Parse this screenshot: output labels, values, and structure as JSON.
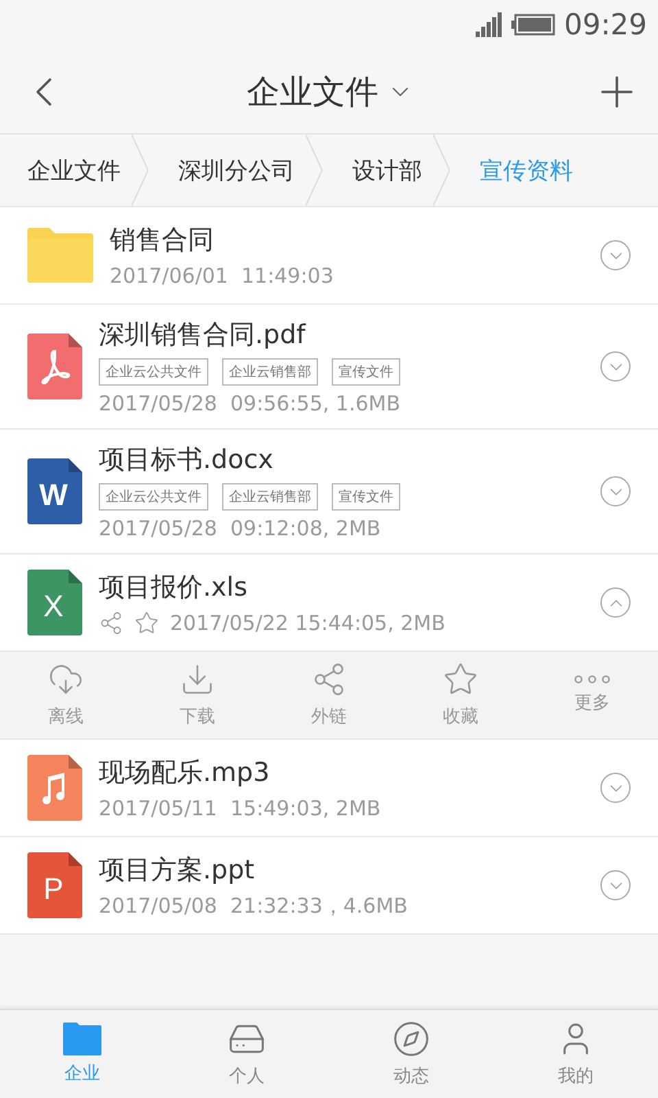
{
  "status_bar": {
    "time": "09:29"
  },
  "header": {
    "title": "企业文件"
  },
  "breadcrumbs": [
    {
      "label": "企业文件",
      "selected": false
    },
    {
      "label": "深圳分公司",
      "selected": false
    },
    {
      "label": "设计部",
      "selected": false
    },
    {
      "label": "宣传资料",
      "selected": true
    }
  ],
  "files": [
    {
      "kind": "folder",
      "name": "销售合同",
      "meta": "2017/06/01  11:49:03",
      "expanded": false
    },
    {
      "kind": "pdf",
      "name": "深圳销售合同.pdf",
      "meta": "2017/05/28  09:56:55, 1.6MB",
      "tags": [
        "企业云公共文件",
        "企业云销售部",
        "宣传文件"
      ],
      "expanded": false
    },
    {
      "kind": "doc",
      "badge": "W",
      "name": "项目标书.docx",
      "meta": "2017/05/28  09:12:08, 2MB",
      "tags": [
        "企业云公共文件",
        "企业云销售部",
        "宣传文件"
      ],
      "expanded": false
    },
    {
      "kind": "sheet",
      "badge": "X",
      "name": "项目报价.xls",
      "meta": "2017/05/22 15:44:05, 2MB",
      "expanded": true
    },
    {
      "kind": "audio",
      "name": "现场配乐.mp3",
      "meta": "2017/05/11  15:49:03, 2MB",
      "expanded": false
    },
    {
      "kind": "slides",
      "badge": "P",
      "name": "项目方案.ppt",
      "meta": "2017/05/08  21:32:33，4.6MB",
      "expanded": false
    }
  ],
  "actions": [
    {
      "kind": "offline",
      "label": "离线"
    },
    {
      "kind": "download",
      "label": "下载"
    },
    {
      "kind": "share",
      "label": "外链"
    },
    {
      "kind": "favorite",
      "label": "收藏"
    },
    {
      "kind": "more",
      "label": "更多"
    }
  ],
  "tabs": [
    {
      "kind": "company",
      "label": "企业",
      "selected": true
    },
    {
      "kind": "personal",
      "label": "个人",
      "selected": false
    },
    {
      "kind": "feed",
      "label": "动态",
      "selected": false
    },
    {
      "kind": "me",
      "label": "我的",
      "selected": false
    }
  ]
}
